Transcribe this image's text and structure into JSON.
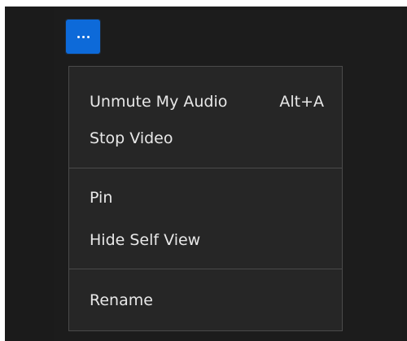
{
  "more_button": {
    "icon": "ellipsis-icon",
    "color": "#0d6ad9"
  },
  "menu": {
    "sections": [
      {
        "items": [
          {
            "label": "Unmute My Audio",
            "shortcut": "Alt+A"
          },
          {
            "label": "Stop Video"
          }
        ]
      },
      {
        "items": [
          {
            "label": "Pin"
          },
          {
            "label": "Hide Self View"
          }
        ]
      },
      {
        "items": [
          {
            "label": "Rename"
          }
        ]
      }
    ]
  }
}
